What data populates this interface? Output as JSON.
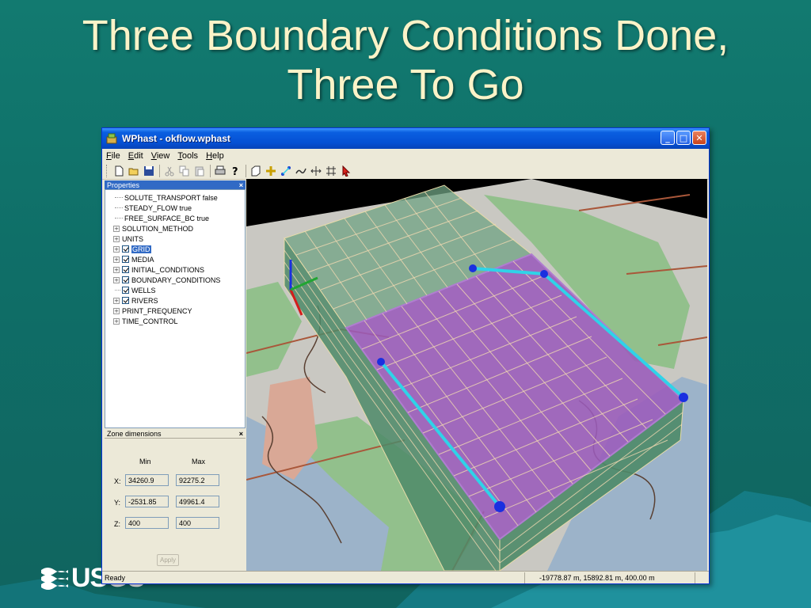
{
  "slide": {
    "title_line1": "Three Boundary Conditions Done,",
    "title_line2": "Three To Go",
    "logo_text": "USGS"
  },
  "window": {
    "title": "WPhast - okflow.wphast",
    "buttons": [
      "minimize",
      "maximize",
      "close"
    ]
  },
  "menu": [
    {
      "label": "File",
      "ul": "F",
      "rest": "ile"
    },
    {
      "label": "Edit",
      "ul": "E",
      "rest": "dit"
    },
    {
      "label": "View",
      "ul": "V",
      "rest": "iew"
    },
    {
      "label": "Tools",
      "ul": "T",
      "rest": "ools"
    },
    {
      "label": "Help",
      "ul": "H",
      "rest": "elp"
    }
  ],
  "toolbar_icons": [
    "new-file-icon",
    "open-folder-icon",
    "save-icon",
    "cut-icon",
    "copy-icon",
    "paste-icon",
    "print-icon",
    "help-icon",
    "zone-icon",
    "crosshair-icon",
    "wells-icon",
    "river-icon",
    "move-grid-icon",
    "grid-icon",
    "pointer-icon"
  ],
  "properties": {
    "title": "Properties",
    "items": [
      {
        "label": "SOLUTE_TRANSPORT false",
        "kind": "leaf"
      },
      {
        "label": "STEADY_FLOW true",
        "kind": "leaf"
      },
      {
        "label": "FREE_SURFACE_BC true",
        "kind": "leaf"
      },
      {
        "label": "SOLUTION_METHOD",
        "kind": "expand"
      },
      {
        "label": "UNITS",
        "kind": "expand"
      },
      {
        "label": "GRID",
        "kind": "expand-check",
        "selected": true
      },
      {
        "label": "MEDIA",
        "kind": "expand-check"
      },
      {
        "label": "INITIAL_CONDITIONS",
        "kind": "expand-check"
      },
      {
        "label": "BOUNDARY_CONDITIONS",
        "kind": "expand-check"
      },
      {
        "label": "WELLS",
        "kind": "check"
      },
      {
        "label": "RIVERS",
        "kind": "expand-check"
      },
      {
        "label": "PRINT_FREQUENCY",
        "kind": "expand"
      },
      {
        "label": "TIME_CONTROL",
        "kind": "expand"
      }
    ]
  },
  "zone": {
    "title": "Zone dimensions",
    "min_label": "Min",
    "max_label": "Max",
    "x_label": "X:",
    "y_label": "Y:",
    "z_label": "Z:",
    "x_min": "34260.9",
    "x_max": "92275.2",
    "y_min": "-2531.85",
    "y_max": "49961.4",
    "z_min": "400",
    "z_max": "400",
    "apply_label": "Apply"
  },
  "status": {
    "text": "Ready",
    "coords": "-19778.87 m, 15892.81 m, 400.00 m"
  },
  "colors": {
    "slide_bg": "#127a70",
    "title_text": "#fbf3c8",
    "xp_blue": "#0550d4",
    "grid_green": "#6fa383",
    "zone_purple": "#9b56b8",
    "river_cyan": "#2fd3e8"
  }
}
